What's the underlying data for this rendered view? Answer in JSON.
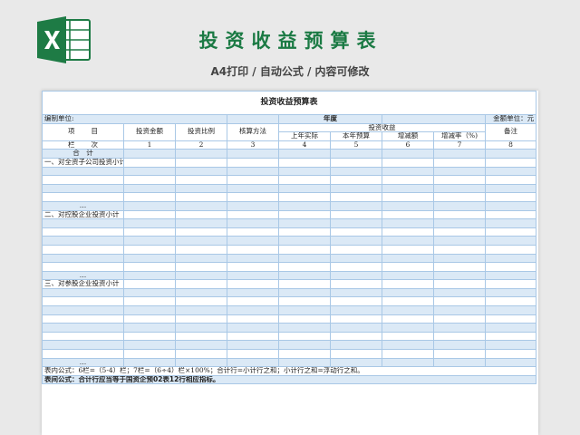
{
  "header": {
    "title": "投资收益预算表",
    "subtitle": "A4打印 / 自动公式 / 内容可修改"
  },
  "colors": {
    "brand_green": "#1b7a44",
    "grid_blue": "#a9c8e6",
    "band_blue": "#dbe9f6"
  },
  "sheet": {
    "title": "投资收益预算表",
    "unit_label": "编制单位:",
    "year_label": "年度",
    "amount_unit": "金额单位：元",
    "headers": {
      "item_a": "项",
      "item_b": "目",
      "invest_amount": "投资金额",
      "invest_ratio": "投资比例",
      "calc_method": "核算方法",
      "income": "投资收益",
      "last_year": "上年实际",
      "this_year": "本年预算",
      "increase": "增减额",
      "increase_rate": "增减率（%)",
      "note": "备注"
    },
    "col_row": {
      "label_a": "栏",
      "label_b": "次",
      "nums": [
        "1",
        "2",
        "3",
        "4",
        "5",
        "6",
        "7",
        "8"
      ]
    },
    "total_label": "合　计",
    "sections": [
      {
        "label": "一、对全资子公司投资小计"
      },
      {
        "label": "二、对控股企业投资小计"
      },
      {
        "label": "三、对参股企业投资小计"
      }
    ],
    "ellipsis": "…",
    "notes": [
      "表内公式：6栏=（5-4）栏；7栏=（6÷4）栏×100%；合计行=小计行之和；小计行之和=浮动行之和。",
      "表间公式：合计行应当等于国资企预02表12行相应指标。"
    ]
  }
}
